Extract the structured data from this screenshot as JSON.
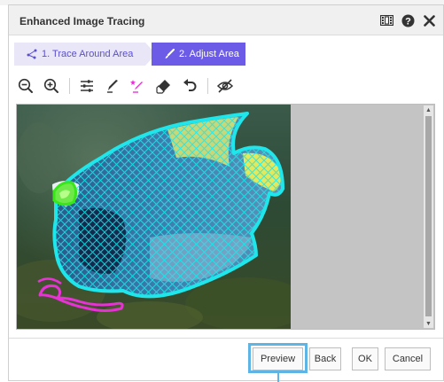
{
  "dialog": {
    "title": "Enhanced Image Tracing",
    "title_icons": [
      "filmstrip-icon",
      "help-icon",
      "close-icon"
    ]
  },
  "steps": [
    {
      "label": "1. Trace Around Area",
      "state": "inactive"
    },
    {
      "label": "2. Adjust Area",
      "state": "active"
    }
  ],
  "toolbar": {
    "tools": [
      "zoom-out-icon",
      "zoom-in-icon",
      "sliders-icon",
      "pen-icon",
      "magic-marker-icon",
      "eraser-icon",
      "undo-icon",
      "visibility-off-icon"
    ]
  },
  "image": {
    "subject": "angelfish traced with cyan outline and hatch",
    "outline_color": "#1fe6ea",
    "remove_mark_color": "#e832d6",
    "add_mark_color": "#39e61a"
  },
  "buttons": {
    "preview": "Preview",
    "back": "Back",
    "ok": "OK",
    "cancel": "Cancel"
  },
  "colors": {
    "accent": "#6b5be6",
    "highlight": "#5fb4e6"
  }
}
